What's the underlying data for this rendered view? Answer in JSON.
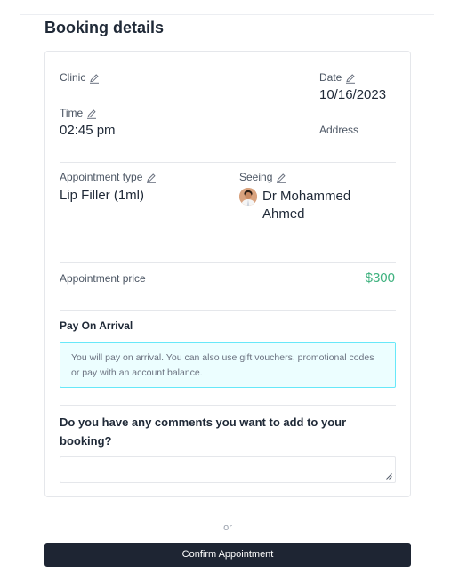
{
  "page": {
    "title": "Booking details"
  },
  "details": {
    "clinic_label": "Clinic",
    "date_label": "Date",
    "date_value": "10/16/2023",
    "time_label": "Time",
    "time_value": "02:45 pm",
    "address_label": "Address",
    "appointment_type_label": "Appointment type",
    "appointment_type_value": "Lip Filler (1ml)",
    "seeing_label": "Seeing",
    "seeing_value": "Dr Mohammed Ahmed",
    "price_label": "Appointment price",
    "price_value": "$300"
  },
  "payment": {
    "heading": "Pay On Arrival",
    "notice": "You will pay on arrival. You can also use gift vouchers, promotional codes or pay with an account balance."
  },
  "comments": {
    "question": "Do you have any comments you want to add to your booking?",
    "value": ""
  },
  "footer": {
    "separator": "or",
    "confirm_label": "Confirm Appointment"
  },
  "colors": {
    "price": "#3fb27f",
    "button_bg": "#1e2533",
    "notice_bg": "#ecfeff",
    "notice_border": "#67e8f9"
  },
  "icons": [
    "pencil-icon",
    "avatar",
    "resize-handle-icon"
  ]
}
